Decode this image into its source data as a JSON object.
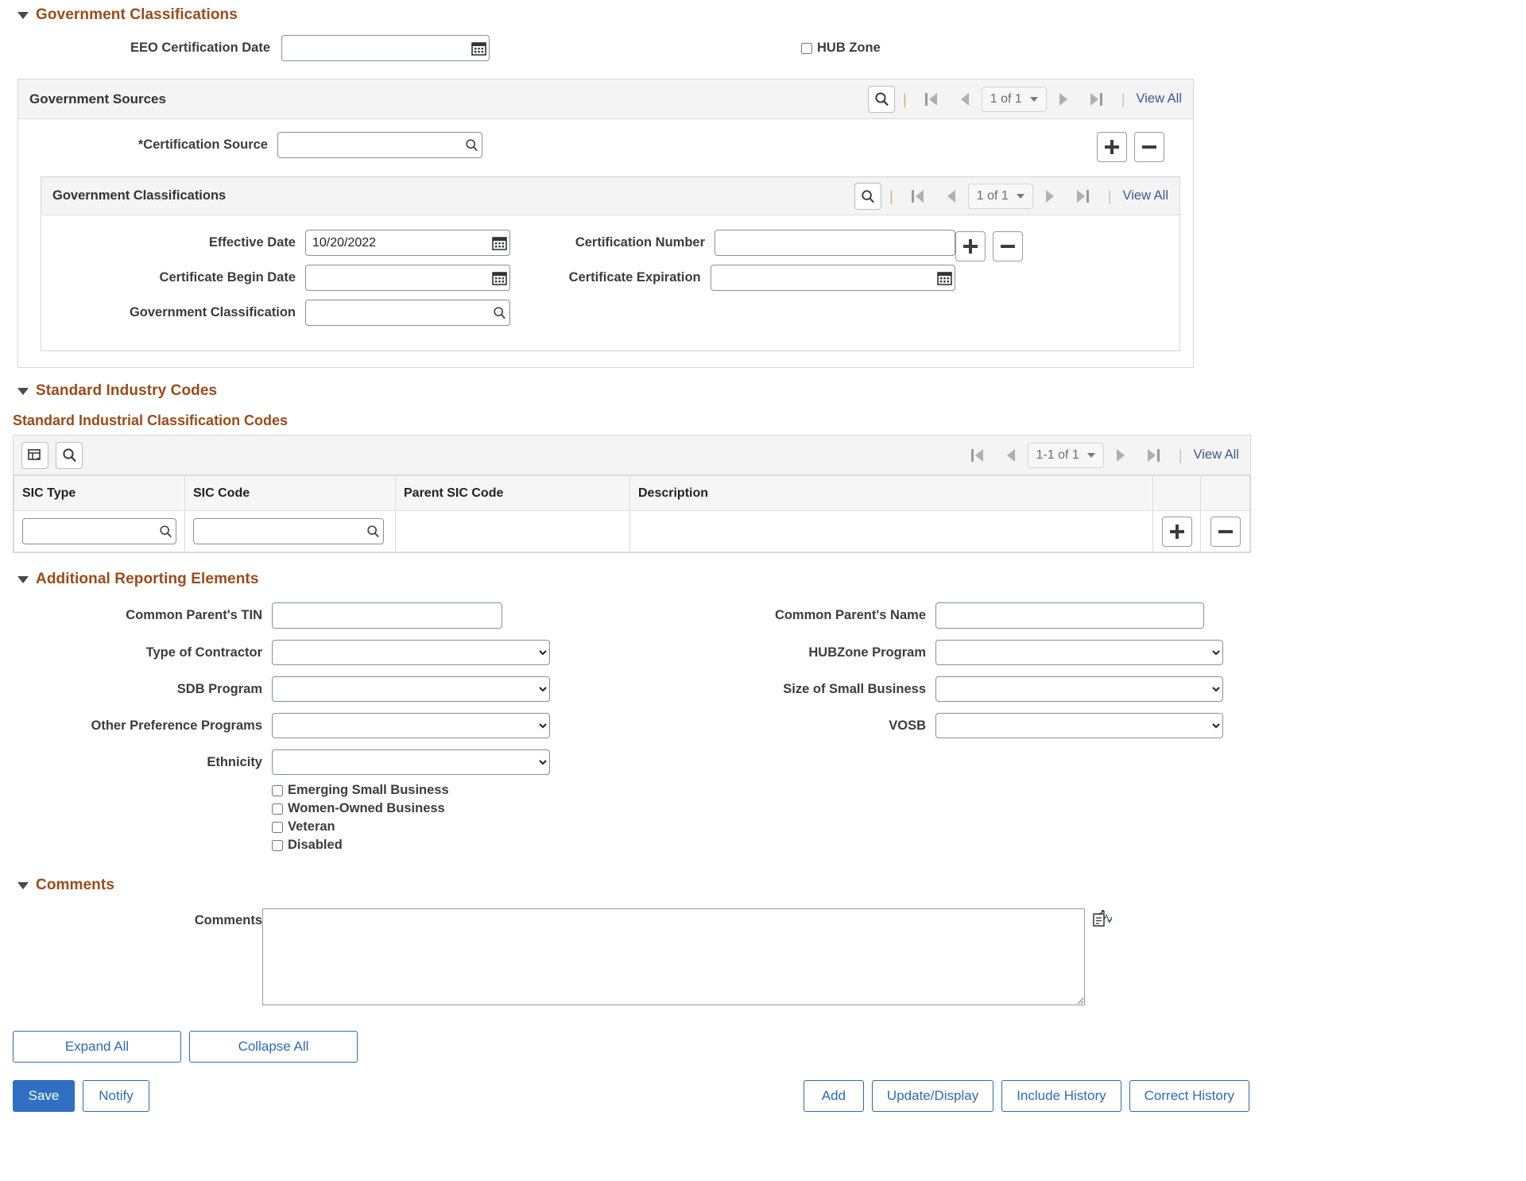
{
  "gov_classifications": {
    "section_title": "Government Classifications",
    "eeo_label": "EEO Certification Date",
    "eeo_value": "",
    "hub_zone_label": "HUB Zone",
    "hub_zone_checked": false
  },
  "gov_sources": {
    "panel_title": "Government Sources",
    "search_icon": "search-icon",
    "page_indicator": "1 of 1",
    "view_all": "View All",
    "certification_source_label": "*Certification Source",
    "certification_source_value": "",
    "add_label": "+",
    "remove_label": "−"
  },
  "gov_class_inner": {
    "panel_title": "Government Classifications",
    "page_indicator": "1 of 1",
    "view_all": "View All",
    "fields": {
      "effective_date_label": "Effective Date",
      "effective_date_value": "10/20/2022",
      "certificate_begin_label": "Certificate Begin Date",
      "certificate_begin_value": "",
      "gov_classification_label": "Government Classification",
      "gov_classification_value": "",
      "certification_number_label": "Certification Number",
      "certification_number_value": "",
      "certificate_expiration_label": "Certificate Expiration",
      "certificate_expiration_value": ""
    }
  },
  "sic": {
    "section_title": "Standard Industry Codes",
    "grid_title": "Standard Industrial Classification Codes",
    "personalize_icon": "grid-personalize-icon",
    "find_icon": "search-icon",
    "page_indicator": "1-1 of 1",
    "view_all": "View All",
    "columns": [
      "SIC Type",
      "SIC Code",
      "Parent SIC Code",
      "Description"
    ],
    "rows": [
      {
        "sic_type": "",
        "sic_code": "",
        "parent_sic_code": "",
        "description": ""
      }
    ]
  },
  "additional": {
    "section_title": "Additional Reporting Elements",
    "left": [
      {
        "label": "Common Parent's TIN",
        "type": "text",
        "value": ""
      },
      {
        "label": "Type of Contractor",
        "type": "select",
        "value": ""
      },
      {
        "label": "SDB Program",
        "type": "select",
        "value": ""
      },
      {
        "label": "Other Preference Programs",
        "type": "select",
        "value": ""
      },
      {
        "label": "Ethnicity",
        "type": "select",
        "value": ""
      }
    ],
    "right": [
      {
        "label": "Common Parent's Name",
        "type": "text",
        "value": ""
      },
      {
        "label": "HUBZone Program",
        "type": "select",
        "value": ""
      },
      {
        "label": "Size of Small Business",
        "type": "select",
        "value": ""
      },
      {
        "label": "VOSB",
        "type": "select",
        "value": ""
      }
    ],
    "checkboxes": [
      {
        "label": "Emerging Small Business",
        "checked": false
      },
      {
        "label": "Women-Owned Business",
        "checked": false
      },
      {
        "label": "Veteran",
        "checked": false
      },
      {
        "label": "Disabled",
        "checked": false
      }
    ]
  },
  "comments": {
    "section_title": "Comments",
    "label": "Comments",
    "value": "",
    "spellcheck_icon": "spellcheck-icon"
  },
  "footer": {
    "expand_all": "Expand All",
    "collapse_all": "Collapse All",
    "save": "Save",
    "notify": "Notify",
    "add": "Add",
    "update_display": "Update/Display",
    "include_history": "Include History",
    "correct_history": "Correct History"
  },
  "colors": {
    "section_heading": "#9c4a1a",
    "link": "#3b5b8c",
    "primary_button": "#2f6fc4"
  }
}
